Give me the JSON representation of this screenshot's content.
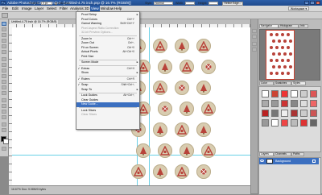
{
  "window": {
    "title": "Adobe Photoshop CS3 Extended - [Untitled-4.75 inch.psp @ 16.7% (RGB/8)]",
    "logo": "Ps"
  },
  "menubar": {
    "items": [
      "File",
      "Edit",
      "Image",
      "Layer",
      "Select",
      "Filter",
      "Analysis",
      "3D",
      "View",
      "Window",
      "Help"
    ],
    "active": "View",
    "workspace_label": "Workspace ▾"
  },
  "options": {
    "feather_label": "Feather:",
    "feather_value": "0 px",
    "antialias_label": "Anti-alias",
    "style_label": "Style:",
    "style_value": "Normal",
    "width_label": "Width:",
    "height_label": "Height:",
    "refine_label": "Refine Edge..."
  },
  "document": {
    "tab_title": "Untitled-4.75 inch @ 16.7% (RGB/8)",
    "status": "16.67%   Doc: 9.08M/0 bytes"
  },
  "view_menu": {
    "rows": [
      {
        "label": "Proof Setup",
        "arrow": true
      },
      {
        "label": "Proof Colors",
        "shortcut": "Ctrl+Y"
      },
      {
        "label": "Gamut Warning",
        "shortcut": "Shift+Ctrl+Y"
      },
      {
        "label": "Pixel Aspect Ratio Correction",
        "disabled": true
      },
      {
        "label": "32-bit Preview Options...",
        "disabled": true
      },
      {
        "sep": true
      },
      {
        "label": "Zoom In",
        "shortcut": "Ctrl++"
      },
      {
        "label": "Zoom Out",
        "shortcut": "Ctrl+-"
      },
      {
        "label": "Fit on Screen",
        "shortcut": "Ctrl+0"
      },
      {
        "label": "Actual Pixels",
        "shortcut": "Alt+Ctrl+0"
      },
      {
        "label": "Print Size"
      },
      {
        "sep": true
      },
      {
        "label": "Screen Mode",
        "arrow": true
      },
      {
        "sep": true
      },
      {
        "label": "Extras",
        "shortcut": "Ctrl+H",
        "checked": true
      },
      {
        "label": "Show",
        "arrow": true
      },
      {
        "sep": true
      },
      {
        "label": "Rulers",
        "shortcut": "Ctrl+R",
        "checked": true
      },
      {
        "sep": true
      },
      {
        "label": "Snap",
        "shortcut": "Shift+Ctrl+;",
        "checked": true
      },
      {
        "label": "Snap To",
        "arrow": true
      },
      {
        "sep": true
      },
      {
        "label": "Lock Guides",
        "shortcut": "Alt+Ctrl+;"
      },
      {
        "label": "Clear Guides"
      },
      {
        "label": "New Guide...",
        "highlighted": true
      },
      {
        "sep": true
      },
      {
        "label": "Lock Slices"
      },
      {
        "label": "Clear Slices",
        "disabled": true
      }
    ]
  },
  "panels": {
    "navigator_tabs": [
      "Navigator",
      "Histogram",
      "Info"
    ],
    "styles_tabs": [
      "Color",
      "Swatches",
      "Styles"
    ],
    "layers_tabs": [
      "Layers",
      "Channels",
      "Paths"
    ],
    "layer_name": "Background"
  },
  "colors": {
    "ornament_red": "#b8433a",
    "ornament_bg": "#d8ccb0",
    "guide": "#6ad0e6",
    "highlight": "#3b6fc0"
  }
}
